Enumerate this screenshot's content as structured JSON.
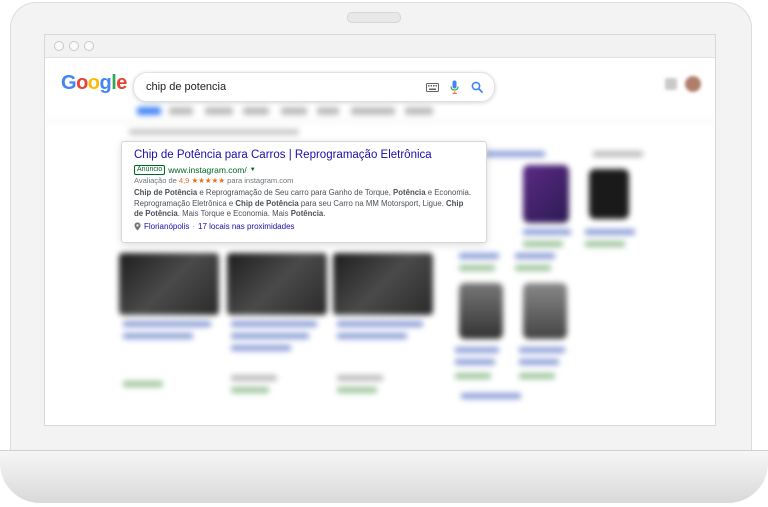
{
  "browser": {
    "search": {
      "logo_letters": [
        "G",
        "o",
        "o",
        "g",
        "l",
        "e"
      ],
      "logo_colors": [
        "#4285F4",
        "#EA4335",
        "#FBBC05",
        "#4285F4",
        "#34A853",
        "#EA4335"
      ],
      "query": "chip de potencia"
    },
    "ad": {
      "title": "Chip de Potência para Carros | Reprogramação Eletrônica",
      "badge": "Anúncio",
      "url": "www.instagram.com/",
      "rating_label": "Avaliação de",
      "rating_value": "4,9",
      "rating_stars": "★★★★★",
      "rating_source": "para instagram.com",
      "desc": [
        {
          "b": "Chip de Potência"
        },
        {
          "t": " e Reprogramação de Seu carro para Ganho de Torque, "
        },
        {
          "b": "Potência"
        },
        {
          "t": " e Economia. Reprogramação Eletrônica e "
        },
        {
          "b": "Chip de Potência"
        },
        {
          "t": " para seu Carro na MM Motorsport, Ligue. "
        },
        {
          "b": "Chip de Potência"
        },
        {
          "t": ". Mais Torque e Economia. Mais "
        },
        {
          "b": "Potência"
        },
        {
          "t": "."
        }
      ],
      "location": "Florianópolis",
      "location_sep": "·",
      "nearby": "17 locais nas proximidades"
    },
    "colors": {
      "link": "#1a0dab",
      "url_green": "#006621",
      "star_orange": "#e7711b"
    }
  }
}
